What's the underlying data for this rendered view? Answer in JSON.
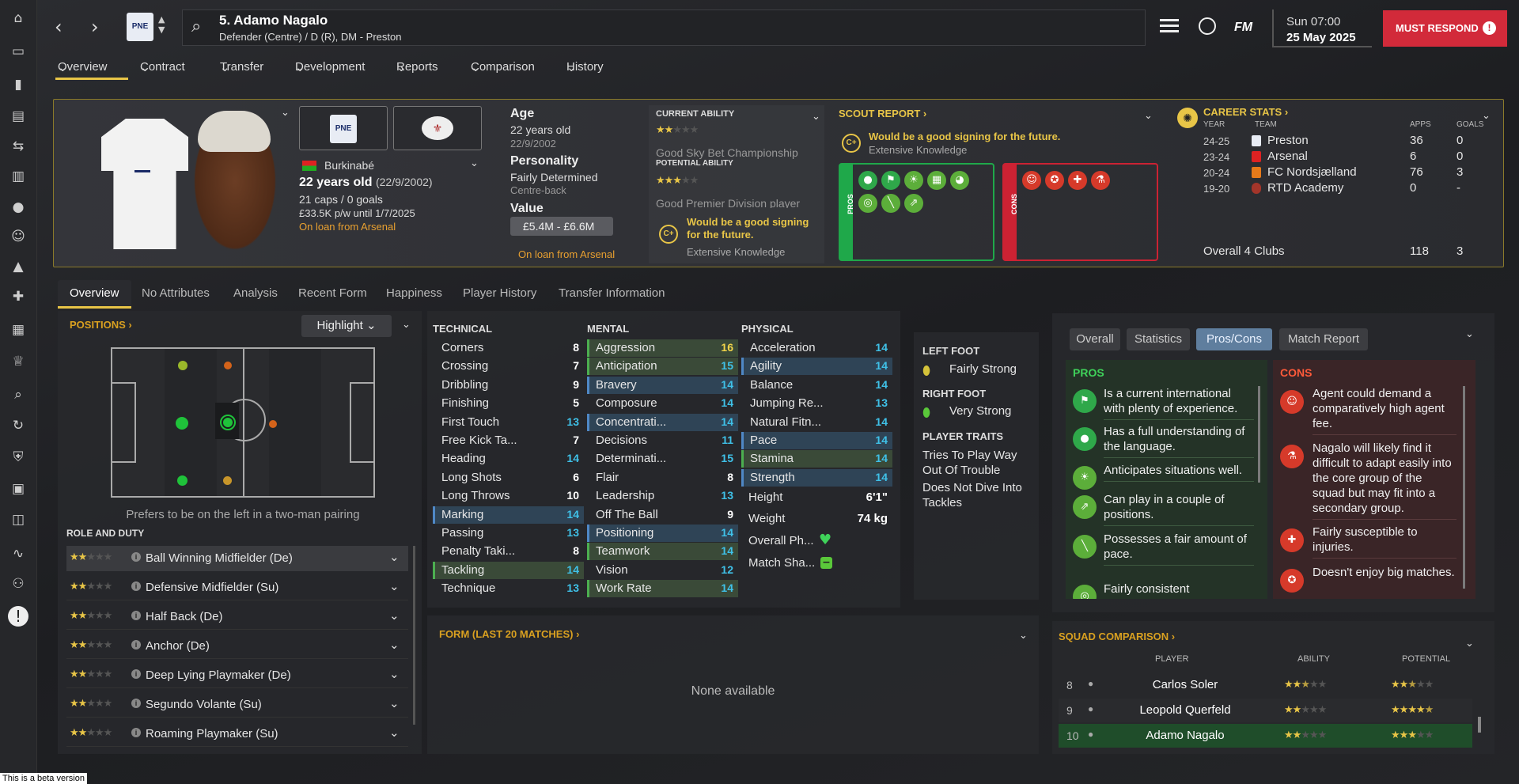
{
  "header": {
    "player_title": "5. Adamo Nagalo",
    "positions": "Defender (Centre) / D (R), DM - Preston",
    "time": "Sun 07:00",
    "date": "25 May 2025",
    "must_respond": "MUST RESPOND",
    "fm_label": "FM"
  },
  "subnav": [
    "Overview",
    "Contract",
    "Transfer",
    "Development",
    "Reports",
    "Comparison",
    "History"
  ],
  "profile": {
    "nationality": "Burkinabé",
    "age_line": "22 years old",
    "dob_paren": "(22/9/2002)",
    "caps": "21 caps / 0 goals",
    "wage": "£33.5K p/w until 1/7/2025",
    "loan": "On loan from Arsenal"
  },
  "bio": {
    "age_label": "Age",
    "age_value": "22 years old",
    "dob": "22/9/2002",
    "personality_label": "Personality",
    "personality": "Fairly Determined",
    "role": "Centre-back",
    "value_label": "Value",
    "value": "£5.4M - £6.6M",
    "loan": "On loan from Arsenal"
  },
  "ability": {
    "current_label": "CURRENT ABILITY",
    "current_stars": 2,
    "current_desc": "Good Sky Bet Championship",
    "potential_label": "POTENTIAL ABILITY",
    "potential_stars": 3,
    "potential_desc": "Good Premier Division player",
    "signing": "Would be a good signing for the future.",
    "knowledge": "Extensive Knowledge",
    "grade": "C+"
  },
  "scout": {
    "title": "SCOUT REPORT",
    "signing": "Would be a good signing for the future.",
    "knowledge": "Extensive Knowledge",
    "pros_label": "PROS",
    "cons_label": "CONS",
    "grade": "C+"
  },
  "career": {
    "title": "CAREER STATS",
    "headers": [
      "YEAR",
      "TEAM",
      "APPS",
      "GOALS"
    ],
    "rows": [
      [
        "24-25",
        "Preston",
        "36",
        "0"
      ],
      [
        "23-24",
        "Arsenal",
        "6",
        "0"
      ],
      [
        "20-24",
        "FC Nordsjælland",
        "76",
        "3"
      ],
      [
        "19-20",
        "RTD Academy",
        "0",
        "-"
      ]
    ],
    "overall": [
      "Overall 4 Clubs",
      "118",
      "3"
    ]
  },
  "tabs": [
    "Overview",
    "No Attributes",
    "Analysis",
    "Recent Form",
    "Happiness",
    "Player History",
    "Transfer Information"
  ],
  "positions": {
    "title": "POSITIONS",
    "highlight": "Highlight",
    "note": "Prefers to be on the left in a two-man pairing",
    "role_title": "ROLE AND DUTY",
    "roles": [
      {
        "name": "Ball Winning Midfielder (De)",
        "stars": 2
      },
      {
        "name": "Defensive Midfielder (Su)",
        "stars": 2
      },
      {
        "name": "Half Back (De)",
        "stars": 2
      },
      {
        "name": "Anchor (De)",
        "stars": 2
      },
      {
        "name": "Deep Lying Playmaker (De)",
        "stars": 2
      },
      {
        "name": "Segundo Volante (Su)",
        "stars": 2
      },
      {
        "name": "Roaming Playmaker (Su)",
        "stars": 2
      }
    ]
  },
  "technical": {
    "title": "TECHNICAL",
    "attrs": [
      [
        "Corners",
        "8"
      ],
      [
        "Crossing",
        "7"
      ],
      [
        "Dribbling",
        "9"
      ],
      [
        "Finishing",
        "5"
      ],
      [
        "First Touch",
        "13"
      ],
      [
        "Free Kick Ta...",
        "7"
      ],
      [
        "Heading",
        "14"
      ],
      [
        "Long Shots",
        "6"
      ],
      [
        "Long Throws",
        "10"
      ],
      [
        "Marking",
        "14"
      ],
      [
        "Passing",
        "13"
      ],
      [
        "Penalty Taki...",
        "8"
      ],
      [
        "Tackling",
        "14"
      ],
      [
        "Technique",
        "13"
      ]
    ]
  },
  "mental": {
    "title": "MENTAL",
    "attrs": [
      [
        "Aggression",
        "16"
      ],
      [
        "Anticipation",
        "15"
      ],
      [
        "Bravery",
        "14"
      ],
      [
        "Composure",
        "14"
      ],
      [
        "Concentrati...",
        "14"
      ],
      [
        "Decisions",
        "11"
      ],
      [
        "Determinati...",
        "15"
      ],
      [
        "Flair",
        "8"
      ],
      [
        "Leadership",
        "13"
      ],
      [
        "Off The Ball",
        "9"
      ],
      [
        "Positioning",
        "14"
      ],
      [
        "Teamwork",
        "14"
      ],
      [
        "Vision",
        "12"
      ],
      [
        "Work Rate",
        "14"
      ]
    ]
  },
  "physical": {
    "title": "PHYSICAL",
    "attrs": [
      [
        "Acceleration",
        "14"
      ],
      [
        "Agility",
        "14"
      ],
      [
        "Balance",
        "14"
      ],
      [
        "Jumping Re...",
        "13"
      ],
      [
        "Natural Fitn...",
        "14"
      ],
      [
        "Pace",
        "14"
      ],
      [
        "Stamina",
        "14"
      ],
      [
        "Strength",
        "14"
      ]
    ],
    "height_label": "Height",
    "height": "6'1\"",
    "weight_label": "Weight",
    "weight": "74 kg",
    "overall_label": "Overall Ph...",
    "match_label": "Match Sha..."
  },
  "feet": {
    "left_label": "LEFT FOOT",
    "left": "Fairly Strong",
    "right_label": "RIGHT FOOT",
    "right": "Very Strong",
    "traits_label": "PLAYER TRAITS",
    "traits": [
      "Tries To Play Way Out Of Trouble",
      "Does Not Dive Into Tackles"
    ]
  },
  "report": {
    "tabs": [
      "Overall",
      "Statistics",
      "Pros/Cons",
      "Match Report"
    ],
    "pros_title": "PROS",
    "cons_title": "CONS",
    "pros": [
      "Is a current international with plenty of experience.",
      "Has a full understanding of the language.",
      "Anticipates situations well.",
      "Can play in a couple of positions.",
      "Possesses a fair amount of pace.",
      "Fairly consistent"
    ],
    "cons": [
      "Agent could demand a comparatively high agent fee.",
      "Nagalo will likely find it difficult to adapt easily into the core group of the squad but may fit into a secondary group.",
      "Fairly susceptible to injuries.",
      "Doesn't enjoy big matches."
    ]
  },
  "form": {
    "title": "FORM (LAST 20 MATCHES)",
    "empty": "None available"
  },
  "squad": {
    "title": "SQUAD COMPARISON",
    "headers": [
      "PLAYER",
      "ABILITY",
      "POTENTIAL"
    ],
    "rows": [
      {
        "num": "8",
        "name": "Carlos Soler",
        "ability": 2.5,
        "potential": 2.5
      },
      {
        "num": "9",
        "name": "Leopold Querfeld",
        "ability": 2,
        "potential": 4.5
      },
      {
        "num": "10",
        "name": "Adamo Nagalo",
        "ability": 2,
        "potential": 3
      }
    ]
  },
  "beta": "This is a beta version",
  "colors": {
    "accent": "#e8c547",
    "must": "#d22a3a",
    "pros": "#1fa84a",
    "cons": "#cc2233",
    "cyan": "#3fc1e8"
  }
}
